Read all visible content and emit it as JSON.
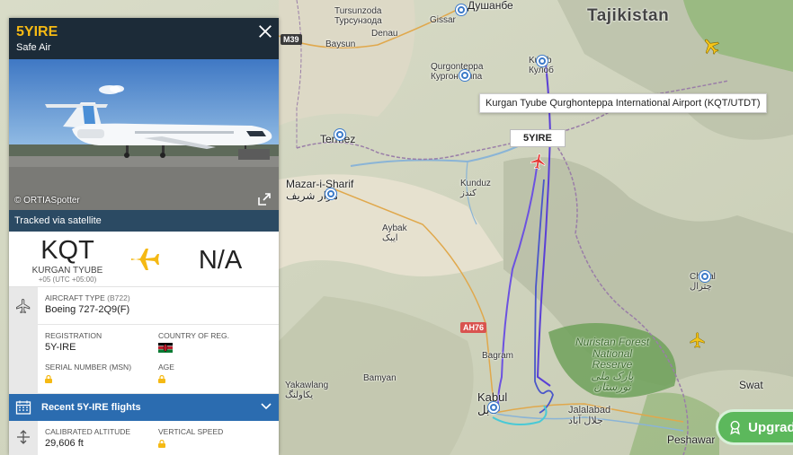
{
  "map": {
    "country_label": "Tajikistan",
    "labels": {
      "tursunzoda": "Tursunzoda\nТурсунзода",
      "dushanbe": "Душанбе",
      "gissar": "Gissar",
      "denau": "Denau",
      "baysun": "Baysun",
      "qurghonteppa": "Qurgonteppa\nКургонтеппа",
      "kulob": "Kulob\nКулоб",
      "termez": "Termez",
      "mazar": "Mazar-i-Sharif\nمزار شریف",
      "kunduz": "Kunduz\nکندز",
      "aybak": "Aybak\nایبک",
      "bagram": "Bagram",
      "bamyan": "Bamyan",
      "yakawlang": "Yakawlang\nیکاولنگ",
      "kabul": "Kabul\nکابل",
      "jalalabad": "Jalalabad\nجلال آباد",
      "chitral": "Chitral\nچترال",
      "swat": "Swat",
      "peshawar": "Peshawar",
      "park": "Nuristan Forest\nNational\nReserve\nپارک ملی\nنورستان"
    },
    "road_badges": {
      "m39": "M39",
      "ah76": "AH76"
    },
    "tooltip": "Kurgan Tyube Qurghonteppa International Airport (KQT/UTDT)",
    "callsign_tag": "5YIRE",
    "upgrade_label": "Upgrade"
  },
  "panel": {
    "callsign": "5YIRE",
    "airline": "Safe Air",
    "photo_credit": "© ORTIASpotter",
    "tracked_via": "Tracked via satellite",
    "origin": {
      "code": "KQT",
      "city": "KURGAN TYUBE",
      "tz": "+05 (UTC +05:00)"
    },
    "destination": {
      "code": "N/A"
    },
    "aircraft_type_label": "AIRCRAFT TYPE",
    "aircraft_type_code": "(B722)",
    "aircraft_type_value": "Boeing 727-2Q9(F)",
    "registration_label": "REGISTRATION",
    "registration_value": "5Y-IRE",
    "country_label": "COUNTRY OF REG.",
    "serial_label": "SERIAL NUMBER (MSN)",
    "age_label": "AGE",
    "recent_flights": "Recent 5Y-IRE flights",
    "altitude_label": "CALIBRATED ALTITUDE",
    "altitude_value": "29,606 ft",
    "vspeed_label": "VERTICAL SPEED"
  },
  "colors": {
    "accent": "#f5b914",
    "panel_header": "#1c2b38",
    "recent_bar": "#2b6cb0",
    "track": "#5a3fd6",
    "upgrade": "#5cb85c"
  }
}
